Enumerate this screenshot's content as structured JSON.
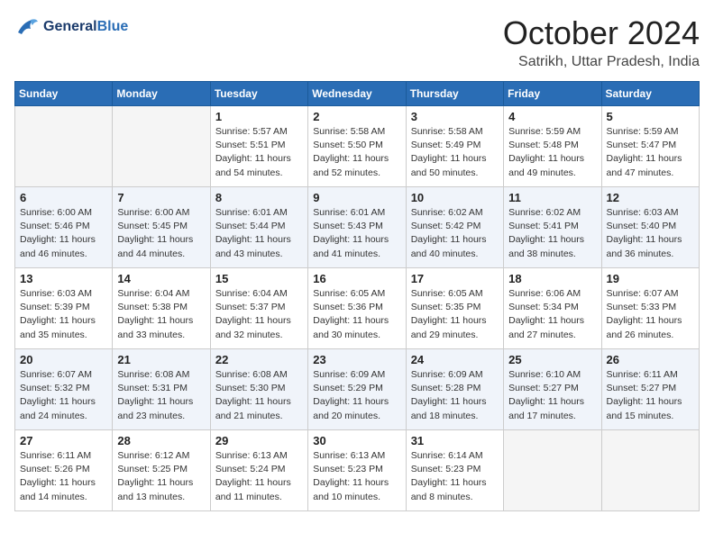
{
  "header": {
    "logo_line1": "General",
    "logo_line2": "Blue",
    "month": "October 2024",
    "location": "Satrikh, Uttar Pradesh, India"
  },
  "days_of_week": [
    "Sunday",
    "Monday",
    "Tuesday",
    "Wednesday",
    "Thursday",
    "Friday",
    "Saturday"
  ],
  "weeks": [
    [
      {
        "day": "",
        "info": ""
      },
      {
        "day": "",
        "info": ""
      },
      {
        "day": "1",
        "info": "Sunrise: 5:57 AM\nSunset: 5:51 PM\nDaylight: 11 hours and 54 minutes."
      },
      {
        "day": "2",
        "info": "Sunrise: 5:58 AM\nSunset: 5:50 PM\nDaylight: 11 hours and 52 minutes."
      },
      {
        "day": "3",
        "info": "Sunrise: 5:58 AM\nSunset: 5:49 PM\nDaylight: 11 hours and 50 minutes."
      },
      {
        "day": "4",
        "info": "Sunrise: 5:59 AM\nSunset: 5:48 PM\nDaylight: 11 hours and 49 minutes."
      },
      {
        "day": "5",
        "info": "Sunrise: 5:59 AM\nSunset: 5:47 PM\nDaylight: 11 hours and 47 minutes."
      }
    ],
    [
      {
        "day": "6",
        "info": "Sunrise: 6:00 AM\nSunset: 5:46 PM\nDaylight: 11 hours and 46 minutes."
      },
      {
        "day": "7",
        "info": "Sunrise: 6:00 AM\nSunset: 5:45 PM\nDaylight: 11 hours and 44 minutes."
      },
      {
        "day": "8",
        "info": "Sunrise: 6:01 AM\nSunset: 5:44 PM\nDaylight: 11 hours and 43 minutes."
      },
      {
        "day": "9",
        "info": "Sunrise: 6:01 AM\nSunset: 5:43 PM\nDaylight: 11 hours and 41 minutes."
      },
      {
        "day": "10",
        "info": "Sunrise: 6:02 AM\nSunset: 5:42 PM\nDaylight: 11 hours and 40 minutes."
      },
      {
        "day": "11",
        "info": "Sunrise: 6:02 AM\nSunset: 5:41 PM\nDaylight: 11 hours and 38 minutes."
      },
      {
        "day": "12",
        "info": "Sunrise: 6:03 AM\nSunset: 5:40 PM\nDaylight: 11 hours and 36 minutes."
      }
    ],
    [
      {
        "day": "13",
        "info": "Sunrise: 6:03 AM\nSunset: 5:39 PM\nDaylight: 11 hours and 35 minutes."
      },
      {
        "day": "14",
        "info": "Sunrise: 6:04 AM\nSunset: 5:38 PM\nDaylight: 11 hours and 33 minutes."
      },
      {
        "day": "15",
        "info": "Sunrise: 6:04 AM\nSunset: 5:37 PM\nDaylight: 11 hours and 32 minutes."
      },
      {
        "day": "16",
        "info": "Sunrise: 6:05 AM\nSunset: 5:36 PM\nDaylight: 11 hours and 30 minutes."
      },
      {
        "day": "17",
        "info": "Sunrise: 6:05 AM\nSunset: 5:35 PM\nDaylight: 11 hours and 29 minutes."
      },
      {
        "day": "18",
        "info": "Sunrise: 6:06 AM\nSunset: 5:34 PM\nDaylight: 11 hours and 27 minutes."
      },
      {
        "day": "19",
        "info": "Sunrise: 6:07 AM\nSunset: 5:33 PM\nDaylight: 11 hours and 26 minutes."
      }
    ],
    [
      {
        "day": "20",
        "info": "Sunrise: 6:07 AM\nSunset: 5:32 PM\nDaylight: 11 hours and 24 minutes."
      },
      {
        "day": "21",
        "info": "Sunrise: 6:08 AM\nSunset: 5:31 PM\nDaylight: 11 hours and 23 minutes."
      },
      {
        "day": "22",
        "info": "Sunrise: 6:08 AM\nSunset: 5:30 PM\nDaylight: 11 hours and 21 minutes."
      },
      {
        "day": "23",
        "info": "Sunrise: 6:09 AM\nSunset: 5:29 PM\nDaylight: 11 hours and 20 minutes."
      },
      {
        "day": "24",
        "info": "Sunrise: 6:09 AM\nSunset: 5:28 PM\nDaylight: 11 hours and 18 minutes."
      },
      {
        "day": "25",
        "info": "Sunrise: 6:10 AM\nSunset: 5:27 PM\nDaylight: 11 hours and 17 minutes."
      },
      {
        "day": "26",
        "info": "Sunrise: 6:11 AM\nSunset: 5:27 PM\nDaylight: 11 hours and 15 minutes."
      }
    ],
    [
      {
        "day": "27",
        "info": "Sunrise: 6:11 AM\nSunset: 5:26 PM\nDaylight: 11 hours and 14 minutes."
      },
      {
        "day": "28",
        "info": "Sunrise: 6:12 AM\nSunset: 5:25 PM\nDaylight: 11 hours and 13 minutes."
      },
      {
        "day": "29",
        "info": "Sunrise: 6:13 AM\nSunset: 5:24 PM\nDaylight: 11 hours and 11 minutes."
      },
      {
        "day": "30",
        "info": "Sunrise: 6:13 AM\nSunset: 5:23 PM\nDaylight: 11 hours and 10 minutes."
      },
      {
        "day": "31",
        "info": "Sunrise: 6:14 AM\nSunset: 5:23 PM\nDaylight: 11 hours and 8 minutes."
      },
      {
        "day": "",
        "info": ""
      },
      {
        "day": "",
        "info": ""
      }
    ]
  ]
}
